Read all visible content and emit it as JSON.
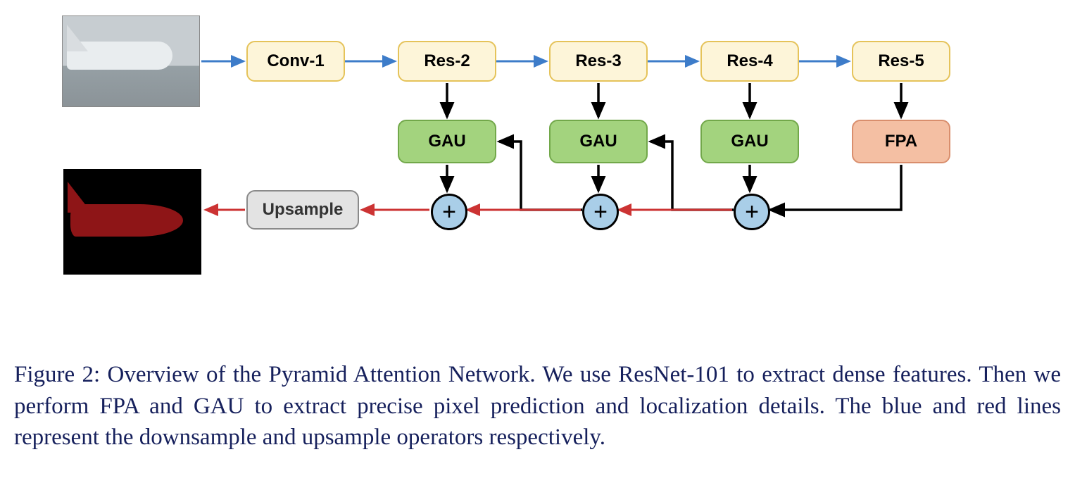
{
  "figure_label": "Figure 2:",
  "caption_text": "Overview of the Pyramid Attention Network. We use ResNet-101 to extract dense features. Then we perform FPA and GAU to extract precise pixel prediction and localization details. The blue and red lines represent the downsample and upsample operators respectively.",
  "nodes": {
    "conv1": "Conv-1",
    "res2": "Res-2",
    "res3": "Res-3",
    "res4": "Res-4",
    "res5": "Res-5",
    "gau1": "GAU",
    "gau2": "GAU",
    "gau3": "GAU",
    "fpa": "FPA",
    "upsample": "Upsample",
    "plus": "+"
  },
  "diagram_structure": {
    "input": "airport-photo",
    "backbone_blocks": [
      "Conv-1",
      "Res-2",
      "Res-3",
      "Res-4",
      "Res-5"
    ],
    "head_modules": {
      "Res-5": "FPA",
      "Res-4": "GAU",
      "Res-3": "GAU",
      "Res-2": "GAU"
    },
    "merge_op": "add",
    "output_block": "Upsample",
    "output": "segmentation-mask",
    "downsample_path_color": "blue",
    "upsample_path_color": "red",
    "internal_path_color": "black"
  }
}
